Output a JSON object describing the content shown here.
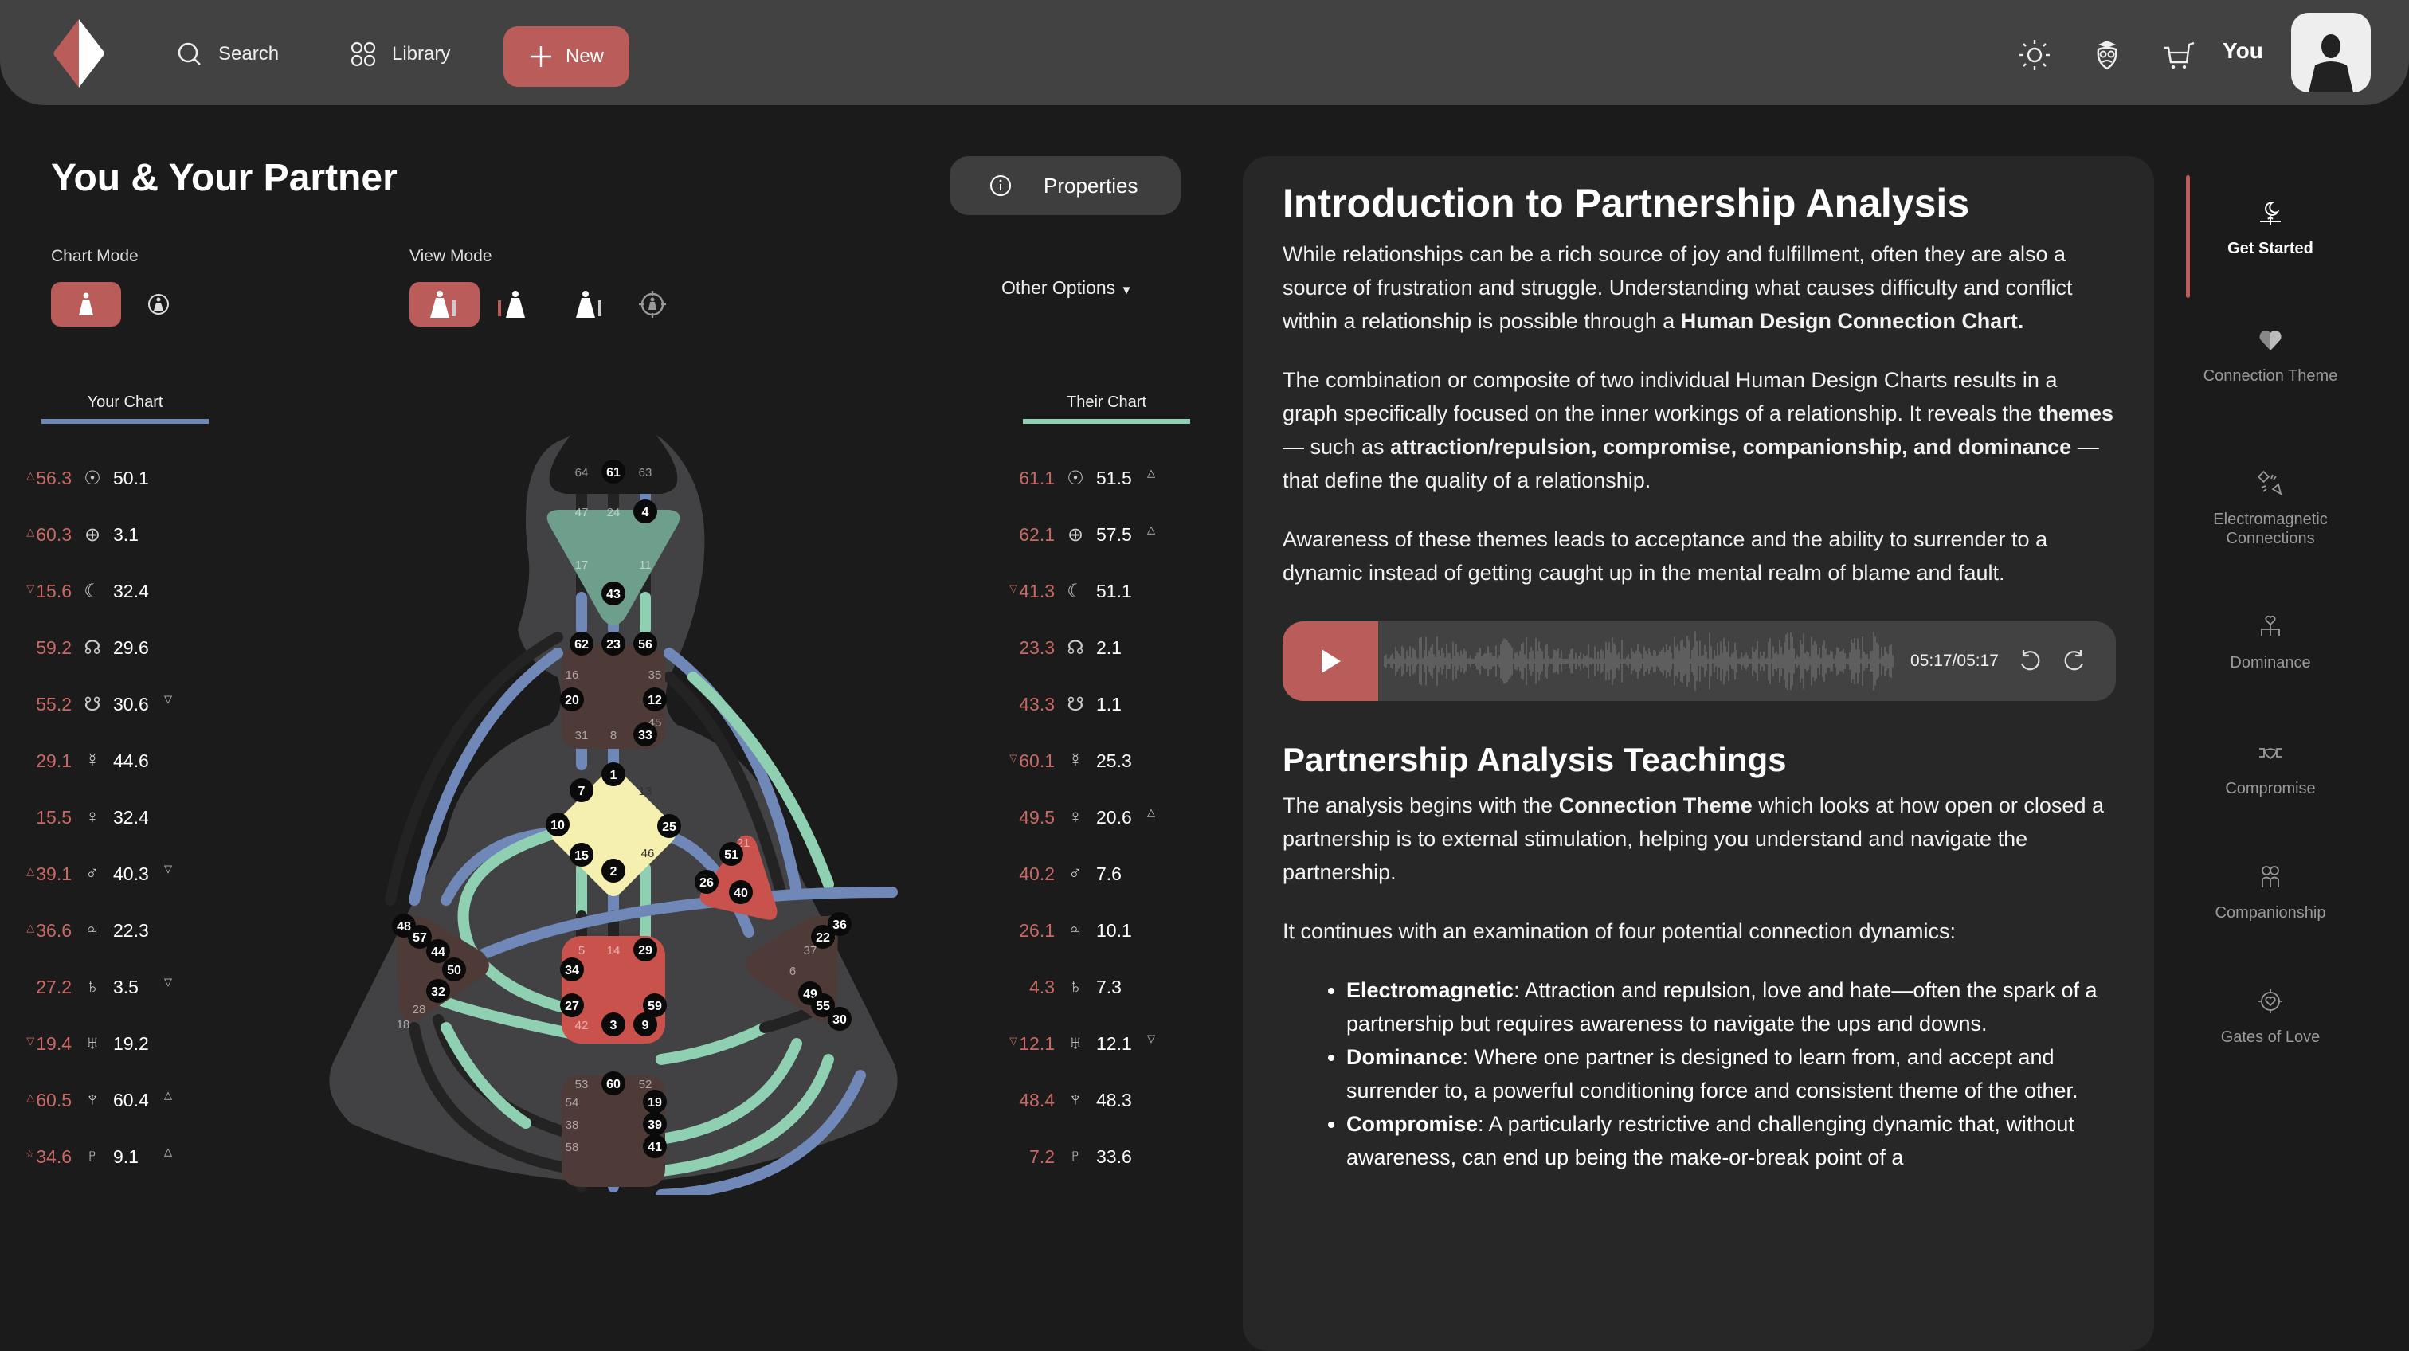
{
  "topbar": {
    "logo": "diamond-logo",
    "nav": [
      {
        "label": "Search",
        "icon": "search-icon"
      },
      {
        "label": "Library",
        "icon": "grid-circles-icon"
      }
    ],
    "new_label": "New",
    "icons": [
      "sun-icon",
      "owl-graduate-icon",
      "cart-icon"
    ],
    "user_label": "You"
  },
  "left": {
    "title": "You & Your Partner",
    "properties_label": "Properties",
    "chart_mode_label": "Chart Mode",
    "view_mode_label": "View Mode",
    "other_options_label": "Other Options",
    "your_chart_label": "Your Chart",
    "their_chart_label": "Their Chart",
    "colors": {
      "your": "#6f88b7",
      "their": "#8fcfb2",
      "accent": "#b95c5a"
    }
  },
  "planets": {
    "symbols": [
      "☉",
      "⊕",
      "☾",
      "☊",
      "☋",
      "☿",
      "♀",
      "♂",
      "♃",
      "♄",
      "♅",
      "♆",
      "♇"
    ],
    "your": [
      {
        "design": "56.3",
        "design_mark": "△",
        "personality": "50.1",
        "pers_mark": ""
      },
      {
        "design": "60.3",
        "design_mark": "△",
        "personality": "3.1",
        "pers_mark": ""
      },
      {
        "design": "15.6",
        "design_mark": "▽",
        "personality": "32.4",
        "pers_mark": ""
      },
      {
        "design": "59.2",
        "design_mark": "",
        "personality": "29.6",
        "pers_mark": ""
      },
      {
        "design": "55.2",
        "design_mark": "",
        "personality": "30.6",
        "pers_mark": "▽"
      },
      {
        "design": "29.1",
        "design_mark": "",
        "personality": "44.6",
        "pers_mark": ""
      },
      {
        "design": "15.5",
        "design_mark": "",
        "personality": "32.4",
        "pers_mark": ""
      },
      {
        "design": "39.1",
        "design_mark": "△",
        "personality": "40.3",
        "pers_mark": "▽"
      },
      {
        "design": "36.6",
        "design_mark": "△",
        "personality": "22.3",
        "pers_mark": ""
      },
      {
        "design": "27.2",
        "design_mark": "",
        "personality": "3.5",
        "pers_mark": "▽"
      },
      {
        "design": "19.4",
        "design_mark": "▽",
        "personality": "19.2",
        "pers_mark": ""
      },
      {
        "design": "60.5",
        "design_mark": "△",
        "personality": "60.4",
        "pers_mark": "△"
      },
      {
        "design": "34.6",
        "design_mark": "☆",
        "personality": "9.1",
        "pers_mark": "△"
      }
    ],
    "their": [
      {
        "design": "61.1",
        "design_mark": "",
        "personality": "51.5",
        "pers_mark": "△"
      },
      {
        "design": "62.1",
        "design_mark": "",
        "personality": "57.5",
        "pers_mark": "△"
      },
      {
        "design": "41.3",
        "design_mark": "▽",
        "personality": "51.1",
        "pers_mark": ""
      },
      {
        "design": "23.3",
        "design_mark": "",
        "personality": "2.1",
        "pers_mark": ""
      },
      {
        "design": "43.3",
        "design_mark": "",
        "personality": "1.1",
        "pers_mark": ""
      },
      {
        "design": "60.1",
        "design_mark": "▽",
        "personality": "25.3",
        "pers_mark": ""
      },
      {
        "design": "49.5",
        "design_mark": "",
        "personality": "20.6",
        "pers_mark": "△"
      },
      {
        "design": "40.2",
        "design_mark": "",
        "personality": "7.6",
        "pers_mark": ""
      },
      {
        "design": "26.1",
        "design_mark": "",
        "personality": "10.1",
        "pers_mark": ""
      },
      {
        "design": "4.3",
        "design_mark": "",
        "personality": "7.3",
        "pers_mark": ""
      },
      {
        "design": "12.1",
        "design_mark": "▽",
        "personality": "12.1",
        "pers_mark": "▽"
      },
      {
        "design": "48.4",
        "design_mark": "",
        "personality": "48.3",
        "pers_mark": ""
      },
      {
        "design": "7.2",
        "design_mark": "",
        "personality": "33.6",
        "pers_mark": ""
      }
    ]
  },
  "bodygraph": {
    "head": {
      "gates": [
        "64",
        "61",
        "63"
      ],
      "active": [
        "61"
      ]
    },
    "ajna": {
      "gates": [
        "47",
        "24",
        "4",
        "17",
        "11",
        "43"
      ],
      "active": [
        "4",
        "43"
      ]
    },
    "throat": {
      "gates": [
        "62",
        "23",
        "56",
        "16",
        "35",
        "20",
        "12",
        "45",
        "31",
        "8",
        "33"
      ],
      "active": [
        "62",
        "23",
        "56",
        "20",
        "12",
        "33"
      ]
    },
    "g": {
      "gates": [
        "1",
        "7",
        "13",
        "10",
        "25",
        "15",
        "46",
        "2"
      ],
      "active": [
        "1",
        "7",
        "10",
        "25",
        "15",
        "2"
      ]
    },
    "heart": {
      "gates": [
        "21",
        "51",
        "26",
        "40"
      ],
      "active": [
        "51",
        "26",
        "40"
      ]
    },
    "spleen": {
      "gates": [
        "48",
        "57",
        "44",
        "50",
        "32",
        "28",
        "18"
      ],
      "active": [
        "48",
        "57",
        "44",
        "50",
        "32"
      ]
    },
    "sacral": {
      "gates": [
        "5",
        "14",
        "29",
        "34",
        "27",
        "59",
        "42",
        "3",
        "9"
      ],
      "active": [
        "29",
        "34",
        "27",
        "59",
        "3",
        "9"
      ]
    },
    "solar": {
      "gates": [
        "36",
        "22",
        "37",
        "6",
        "49",
        "55",
        "30"
      ],
      "active": [
        "36",
        "22",
        "49",
        "55",
        "30"
      ]
    },
    "root": {
      "gates": [
        "53",
        "60",
        "52",
        "54",
        "19",
        "38",
        "39",
        "58",
        "41"
      ],
      "active": [
        "60",
        "19",
        "39",
        "41"
      ]
    }
  },
  "content": {
    "intro_title": "Introduction to Partnership Analysis",
    "p1_a": "While relationships can be a rich source of joy and fulfillment, often they are also a source of frustration and struggle. Understanding what causes difficulty and conflict within a relationship is possible through a ",
    "p1_b": "Human Design Connection Chart.",
    "p2_a": "The combination or composite of two individual Human Design Charts results in a graph specifically focused on the inner workings of a relationship. It reveals the ",
    "p2_b": "themes",
    "p2_c": " — such as ",
    "p2_d": "attraction/repulsion, compromise, companionship, and dominance",
    "p2_e": " — that define the quality of a relationship.",
    "p3": "Awareness of these themes leads to acceptance and the ability to surrender to a dynamic instead of getting caught up in the mental realm of blame and fault.",
    "audio_time": "05:17/05:17",
    "audio_progress": 1.0,
    "teach_title": "Partnership Analysis Teachings",
    "p4_a": "The analysis begins with the ",
    "p4_b": "Connection Theme",
    "p4_c": " which looks at how open or closed a partnership is to external stimulation, helping you understand and navigate the partnership.",
    "p5": "It continues with an examination of four potential connection dynamics:",
    "bullets": [
      {
        "term": "Electromagnetic",
        "text": ": Attraction and repulsion, love and hate—often the spark of a partnership but requires awareness to navigate the ups and downs."
      },
      {
        "term": "Dominance",
        "text": ": Where one partner is designed to learn from, and accept and surrender to, a powerful conditioning force and consistent theme of the other."
      },
      {
        "term": "Compromise",
        "text": ": A particularly restrictive and challenging dynamic that, without awareness, can end up being the make-or-break point of a"
      }
    ]
  },
  "sidenav": [
    {
      "label": "Get Started",
      "icon": "moon-rise-icon",
      "active": true
    },
    {
      "label": "Connection Theme",
      "icon": "half-heart-icon"
    },
    {
      "label": "Electromagnetic Connections",
      "icon": "magnet-spark-icon"
    },
    {
      "label": "Dominance",
      "icon": "hierarchy-heart-icon"
    },
    {
      "label": "Compromise",
      "icon": "handshake-icon"
    },
    {
      "label": "Companionship",
      "icon": "two-people-icon"
    },
    {
      "label": "Gates of Love",
      "icon": "heart-target-icon"
    }
  ]
}
